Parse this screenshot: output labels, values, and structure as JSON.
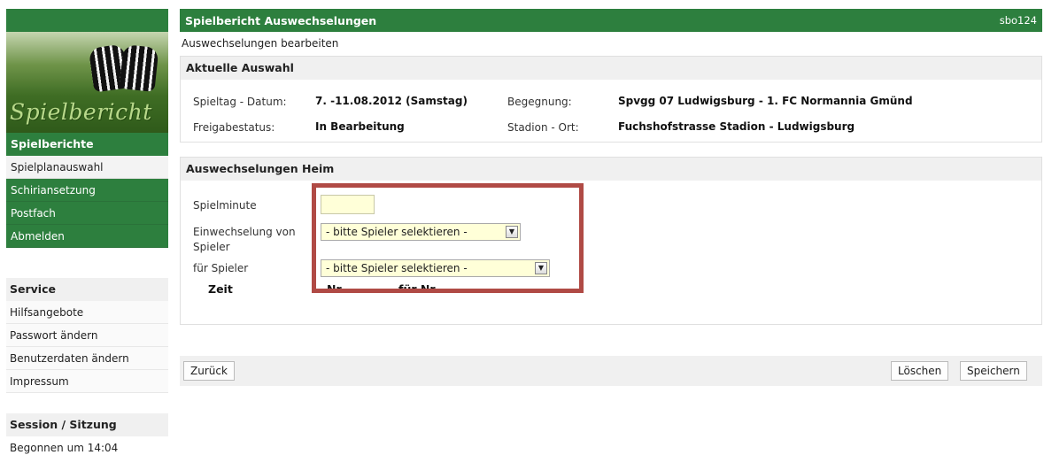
{
  "sidebar": {
    "banner_title": "Spielbericht",
    "nav_header": "Spielberichte",
    "nav_items": [
      "Spielplanauswahl",
      "Schiriansetzung",
      "Postfach",
      "Abmelden"
    ],
    "service": {
      "header": "Service",
      "links": [
        "Hilfsangebote",
        "Passwort ändern",
        "Benutzerdaten ändern",
        "Impressum"
      ]
    },
    "session": {
      "header": "Session / Sitzung",
      "started": "Begonnen um 14:04"
    }
  },
  "header": {
    "title": "Spielbericht Auswechselungen",
    "code": "sbo124",
    "subtitle": "Auswechselungen bearbeiten"
  },
  "selection": {
    "header": "Aktuelle Auswahl",
    "matchday_label": "Spieltag - Datum:",
    "matchday_value": "7. -11.08.2012 (Samstag)",
    "match_label": "Begegnung:",
    "match_value": "Spvgg 07 Ludwigsburg - 1. FC Normannia Gmünd",
    "status_label": "Freigabestatus:",
    "status_value": "In Bearbeitung",
    "stadium_label": "Stadion - Ort:",
    "stadium_value": "Fuchshofstrasse Stadion - Ludwigsburg"
  },
  "substitutions": {
    "header": "Auswechselungen Heim",
    "minute_label": "Spielminute",
    "minute_value": "",
    "in_label_line1": "Einwechselung von",
    "in_label_line2": "Spieler",
    "in_select": "- bitte Spieler selektieren -",
    "for_label": "für Spieler",
    "for_select": "- bitte Spieler selektieren -",
    "columns": [
      "Zeit",
      "Nr",
      "für Nr."
    ]
  },
  "footer": {
    "back": "Zurück",
    "delete": "Löschen",
    "save": "Speichern"
  },
  "colors": {
    "primary_green": "#2d7f3e",
    "highlight_red": "#b04a45",
    "input_bg": "#ffffd8"
  }
}
